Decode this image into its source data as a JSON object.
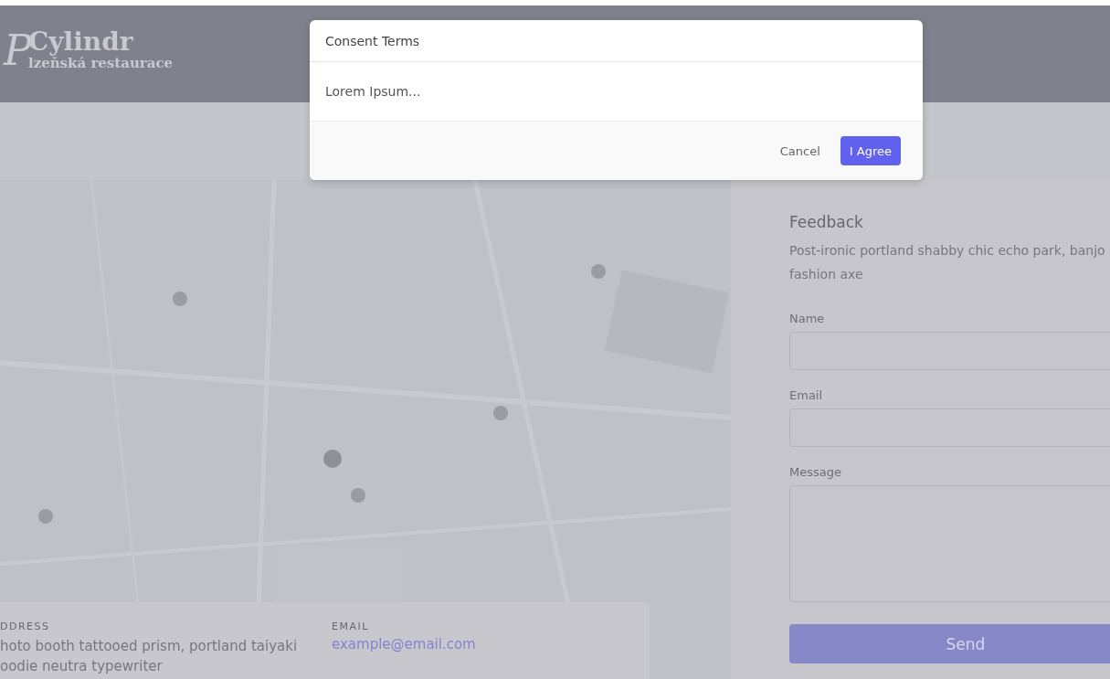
{
  "header": {
    "logo_mark": "P",
    "logo_title": "Cylindr",
    "logo_subtitle": "lzeňská restaurace"
  },
  "contact_card": {
    "address_label": "DDRESS",
    "address_lines": [
      "hoto booth tattooed prism, portland taiyaki",
      "oodie neutra typewriter"
    ],
    "email_label": "EMAIL",
    "email": "example@email.com"
  },
  "feedback": {
    "title": "Feedback",
    "description": "Post-ironic portland shabby chic echo park, banjo fashion axe",
    "fields": [
      {
        "label": "Name",
        "kind": "input"
      },
      {
        "label": "Email",
        "kind": "input"
      },
      {
        "label": "Message",
        "kind": "textarea"
      }
    ],
    "submit": "Send"
  },
  "modal": {
    "title": "Consent Terms",
    "body": "Lorem Ipsum...",
    "buttons": [
      {
        "label": "Cancel",
        "kind": "secondary"
      },
      {
        "label": "I Agree",
        "kind": "primary"
      }
    ]
  }
}
